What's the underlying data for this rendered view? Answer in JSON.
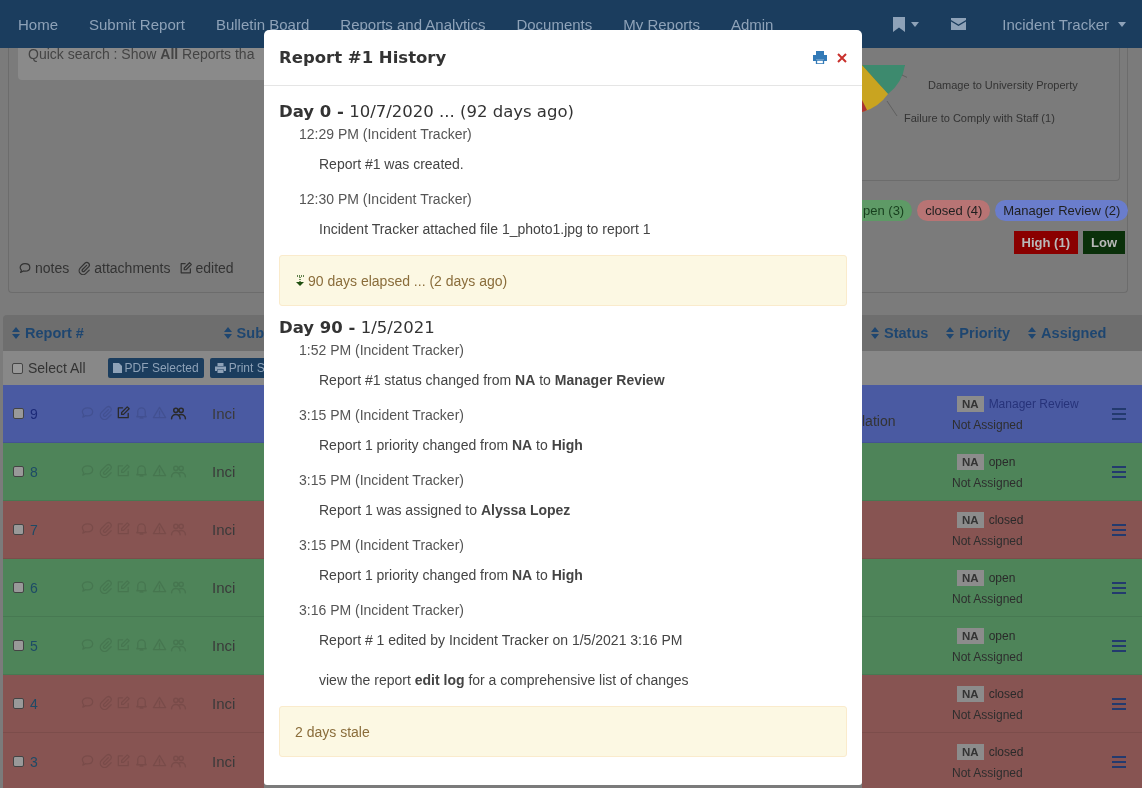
{
  "navbar": {
    "items": [
      {
        "label": "Home"
      },
      {
        "label": "Submit Report"
      },
      {
        "label": "Bulletin Board"
      },
      {
        "label": "Reports and Analytics"
      },
      {
        "label": "Documents"
      },
      {
        "label": "My Reports"
      },
      {
        "label": "Admin"
      }
    ],
    "user": "Incident Tracker"
  },
  "quick_search": "Quick search : Show **All** Reports tha",
  "chart_labels": [
    "Damage to University Property",
    "Failure to Comply with Staff (1)"
  ],
  "legend": [
    {
      "kind": "notes",
      "label": "notes"
    },
    {
      "kind": "attachments",
      "label": "attachments"
    },
    {
      "kind": "edited",
      "label": "edited"
    }
  ],
  "status_pills": [
    {
      "label": "pen (3)",
      "color": "#5e9a66"
    },
    {
      "label": "closed (4)",
      "color": "#b87474"
    },
    {
      "label": "Manager Review (2)",
      "color": "#6a7dcc"
    }
  ],
  "priority_badges": [
    {
      "label": "High (1)",
      "color": "#8a0000"
    },
    {
      "label": "Low",
      "color": "#0a300a"
    }
  ],
  "table": {
    "columns_left": [
      "Report #",
      "Sub"
    ],
    "columns_right": [
      "Status",
      "Priority",
      "Assigned"
    ],
    "select_all": {
      "label": "Select All",
      "checked": false
    },
    "actions": [
      "PDF Selected",
      "Print S"
    ],
    "rows": [
      {
        "number": "9",
        "color": "#4a5aa2",
        "checked": false,
        "edited": true,
        "team": true,
        "subject": "Inci",
        "note": "lation",
        "priority": "NA",
        "status": "Manager Review",
        "assigned": "Not Assigned"
      },
      {
        "number": "8",
        "color": "#4e8459",
        "checked": false,
        "edited": false,
        "team": false,
        "subject": "Inci",
        "priority": "NA",
        "status": "open",
        "assigned": "Not Assigned"
      },
      {
        "number": "7",
        "color": "#875452",
        "checked": false,
        "edited": false,
        "team": false,
        "subject": "Inci",
        "priority": "NA",
        "status": "closed",
        "assigned": "Not Assigned"
      },
      {
        "number": "6",
        "color": "#4e8459",
        "checked": false,
        "edited": false,
        "team": false,
        "subject": "Inci",
        "priority": "NA",
        "status": "open",
        "assigned": "Not Assigned"
      },
      {
        "number": "5",
        "color": "#4e8459",
        "checked": false,
        "edited": false,
        "team": false,
        "subject": "Inci",
        "priority": "NA",
        "status": "open",
        "assigned": "Not Assigned"
      },
      {
        "number": "4",
        "color": "#875452",
        "checked": false,
        "edited": false,
        "team": false,
        "subject": "Inci",
        "priority": "NA",
        "status": "closed",
        "assigned": "Not Assigned"
      },
      {
        "number": "3",
        "color": "#875452",
        "checked": false,
        "edited": false,
        "team": false,
        "subject": "Inci",
        "priority": "NA",
        "status": "closed",
        "assigned": "Not Assigned"
      }
    ]
  },
  "modal": {
    "title": "Report #1 History",
    "sections": [
      {
        "kind": "day",
        "heading": "**Day 0 -** 10/7/2020 ... (92 days ago)",
        "entries": [
          {
            "time": "12:29 PM (Incident Tracker)",
            "messages": [
              "Report #1 was created."
            ]
          },
          {
            "time": "12:30 PM (Incident Tracker)",
            "messages": [
              "Incident Tracker attached file 1_photo1.jpg to report 1"
            ]
          }
        ]
      },
      {
        "kind": "elapsed",
        "text": "90 days elapsed ... (2 days ago)"
      },
      {
        "kind": "day",
        "heading": "**Day 90 -** 1/5/2021",
        "entries": [
          {
            "time": "1:52 PM (Incident Tracker)",
            "messages": [
              "Report #1 status changed from **NA** to **Manager Review**"
            ]
          },
          {
            "time": "3:15 PM (Incident Tracker)",
            "messages": [
              "Report 1 priority changed from **NA** to **High**"
            ]
          },
          {
            "time": "3:15 PM (Incident Tracker)",
            "messages": [
              "Report 1 was assigned to **Alyssa Lopez**"
            ]
          },
          {
            "time": "3:15 PM (Incident Tracker)",
            "messages": [
              "Report 1 priority changed from **NA** to **High**"
            ]
          },
          {
            "time": "3:16 PM (Incident Tracker)",
            "messages": [
              "Report # 1 edited by Incident Tracker on 1/5/2021 3:16 PM",
              "view the report **edit log** for a comprehensive list of changes"
            ]
          }
        ]
      },
      {
        "kind": "stale",
        "text": "2 days stale"
      }
    ]
  }
}
